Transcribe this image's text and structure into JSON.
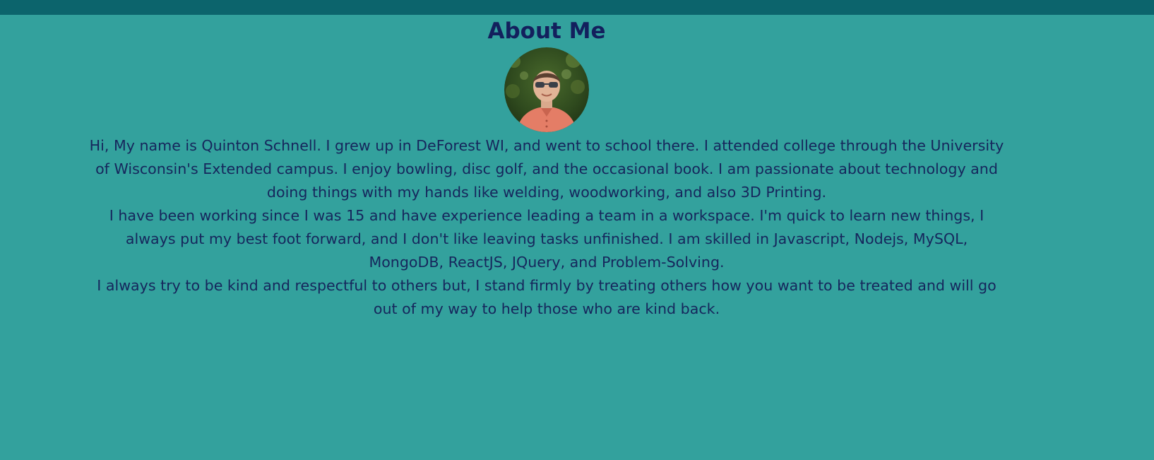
{
  "header": {
    "title": "About Me"
  },
  "profile": {
    "photo_icon": "profile-photo"
  },
  "bio": {
    "paragraphs": [
      "Hi, My name is Quinton Schnell. I grew up in DeForest WI, and went to school there. I attended college through the University of Wisconsin's Extended campus. I enjoy bowling, disc golf, and the occasional book. I am passionate about technology and doing things with my hands like welding, woodworking, and also 3D Printing.",
      "I have been working since I was 15 and have experience leading a team in a workspace. I'm quick to learn new things, I always put my best foot forward, and I don't like leaving tasks unfinished. I am skilled in Javascript, Nodejs, MySQL, MongoDB, ReactJS, JQuery, and Problem-Solving.",
      "I always try to be kind and respectful to others but, I stand firmly by treating others how you want to be treated and will go out of my way to help those who are kind back."
    ]
  },
  "colors": {
    "background": "#33a19d",
    "top_bar": "#0c646c",
    "heading": "#13205d",
    "text": "#16265c"
  }
}
